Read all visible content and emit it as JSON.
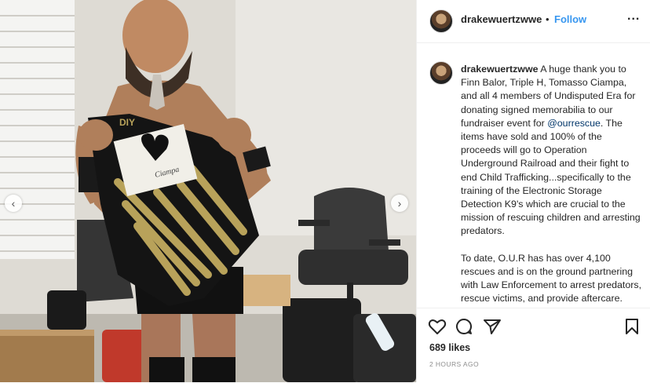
{
  "post": {
    "username": "drakewuertzwwe",
    "dot": "•",
    "follow_label": "Follow",
    "more_label": "...",
    "caption_intro": "A huge thank you to Finn Balor, Triple H, Tomasso Ciampa, and all 4 members of Undisputed Era for donating signed memorabilia to our fundraiser event for ",
    "caption_mention": "@ourrescue",
    "caption_rest": ". The items have sold and 100% of the proceeds will go to Operation Underground Railroad and their fight to end Child Trafficking...specifically to the training of the Electronic Storage Detection K9's which are crucial to the mission of rescuing children and arresting predators.",
    "caption_para2": "To date, O.U.R has has over 4,100 rescues and is on the ground partnering with Law Enforcement to arrest predators, rescue victims, and provide aftercare.",
    "likes": "689 likes",
    "time_ago": "2 HOURS AGO"
  },
  "carousel": {
    "left_arrow": "‹",
    "right_arrow": "›"
  },
  "photo": {
    "shirt_text": "DIY",
    "signature": "Ciampa"
  },
  "colors": {
    "follow": "#3897f0",
    "link": "#003569",
    "muted": "#8e8e8e",
    "shirt_stripes": "#b8a25a"
  }
}
